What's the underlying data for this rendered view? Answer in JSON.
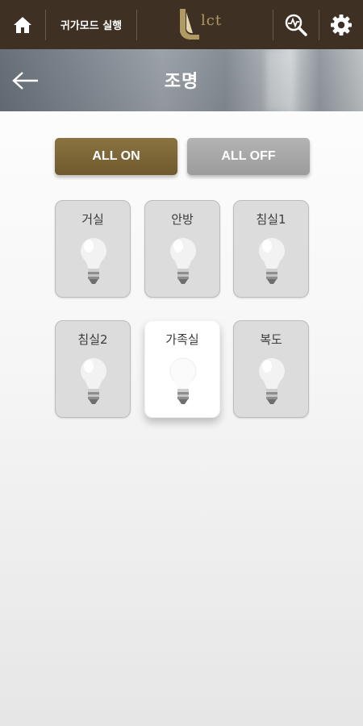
{
  "topbar": {
    "home_icon": "home-icon",
    "homemode_label": "귀가모드 실행",
    "logo_text": "lct",
    "search_icon": "search-zoom-icon",
    "settings_icon": "gear-icon"
  },
  "header": {
    "back_icon": "arrow-left-icon",
    "title": "조명"
  },
  "controls": {
    "all_on_label": "ALL ON",
    "all_off_label": "ALL OFF"
  },
  "rooms": [
    {
      "name": "거실",
      "on": false
    },
    {
      "name": "안방",
      "on": false
    },
    {
      "name": "침실1",
      "on": false
    },
    {
      "name": "침실2",
      "on": false
    },
    {
      "name": "가족실",
      "on": true
    },
    {
      "name": "복도",
      "on": false
    }
  ],
  "colors": {
    "topbar": "#3f3024",
    "all_on": "#7d683a",
    "all_off": "#a8a8a8",
    "logo": "#b09a63"
  }
}
